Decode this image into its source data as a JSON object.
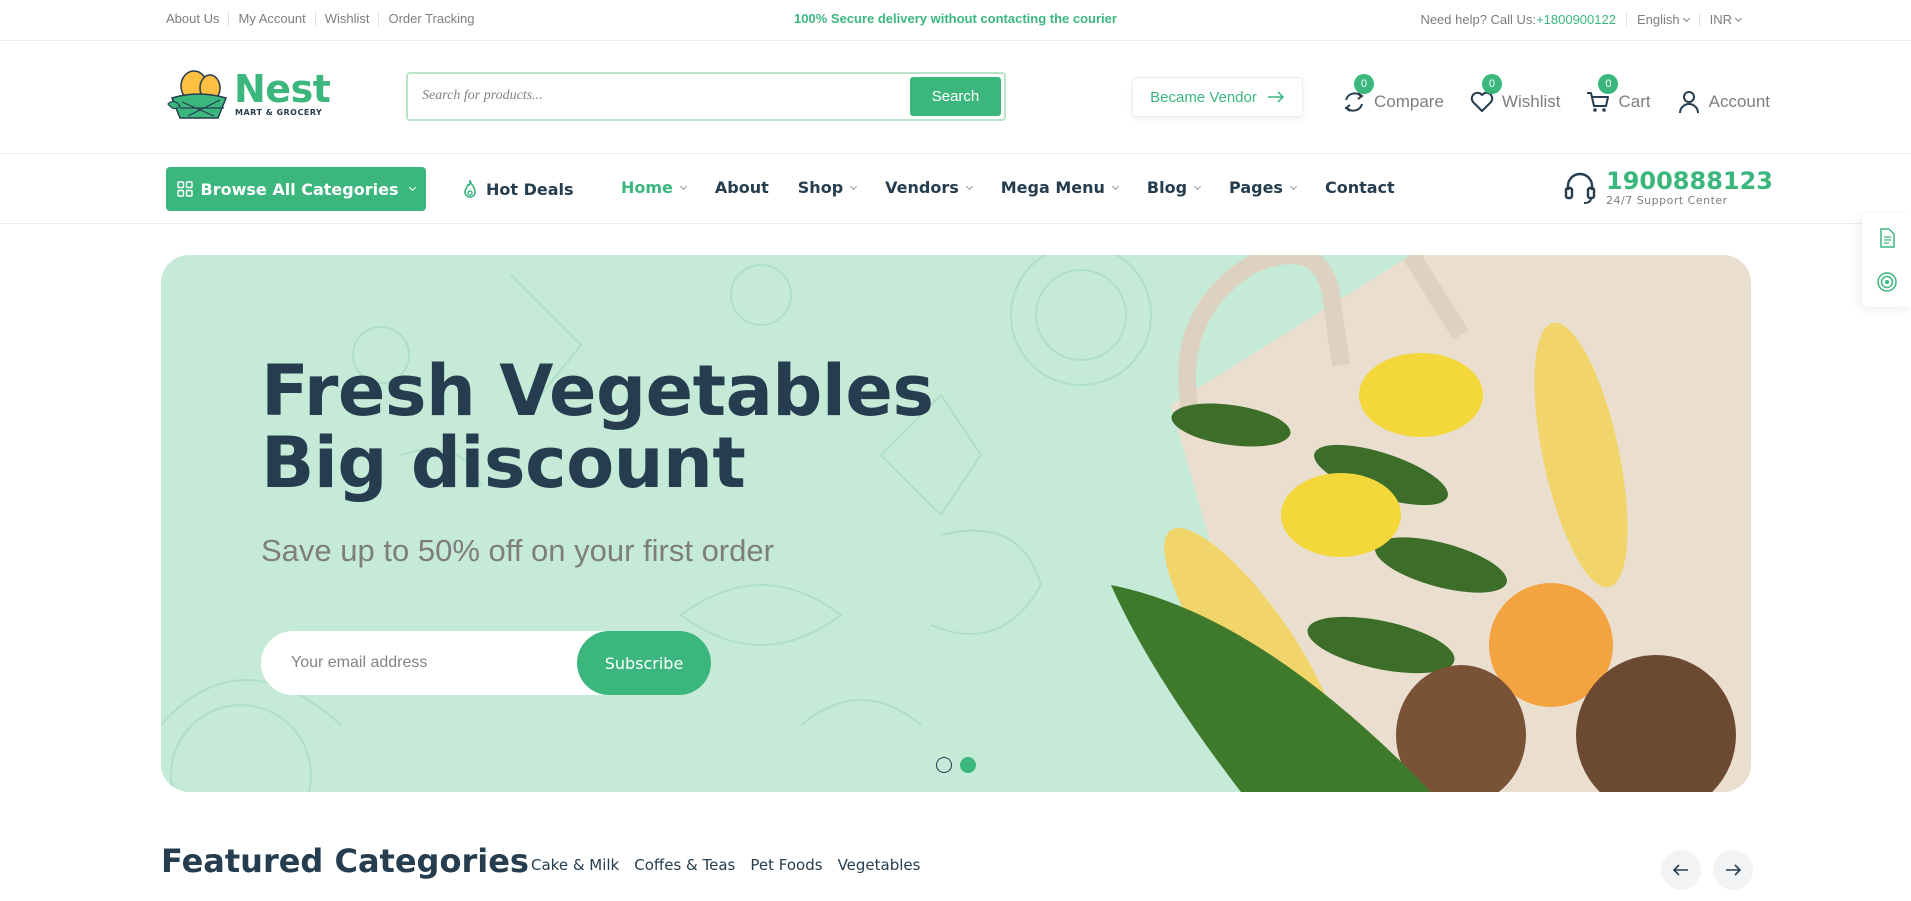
{
  "topbar": {
    "links": [
      "About Us",
      "My Account",
      "Wishlist",
      "Order Tracking"
    ],
    "promo": "100% Secure delivery without contacting the courier",
    "help_prefix": "Need help? Call Us:",
    "help_phone": "+1800900122",
    "language": "English",
    "currency": "INR"
  },
  "header": {
    "logo_name": "Nest",
    "logo_tagline": "MART & GROCERY",
    "search_placeholder": "Search for products...",
    "search_button": "Search",
    "vendor_button": "Became Vendor",
    "compare": {
      "label": "Compare",
      "count": "0"
    },
    "wishlist": {
      "label": "Wishlist",
      "count": "0"
    },
    "cart": {
      "label": "Cart",
      "count": "0"
    },
    "account": {
      "label": "Account"
    }
  },
  "nav": {
    "browse": "Browse All Categories",
    "hot_deals": "Hot Deals",
    "items": [
      {
        "label": "Home",
        "dropdown": true,
        "active": true
      },
      {
        "label": "About",
        "dropdown": false
      },
      {
        "label": "Shop",
        "dropdown": true
      },
      {
        "label": "Vendors",
        "dropdown": true
      },
      {
        "label": "Mega Menu",
        "dropdown": true
      },
      {
        "label": "Blog",
        "dropdown": true
      },
      {
        "label": "Pages",
        "dropdown": true
      },
      {
        "label": "Contact",
        "dropdown": false
      }
    ],
    "support_number": "1900888123",
    "support_label": "24/7 Support Center"
  },
  "hero": {
    "title_line1": "Fresh Vegetables",
    "title_line2": "Big discount",
    "subtitle": "Save up to 50% off on your first order",
    "email_placeholder": "Your email address",
    "subscribe_button": "Subscribe",
    "slide_count": 2,
    "active_slide": 2
  },
  "featured": {
    "title": "Featured Categories",
    "tabs": [
      "Cake & Milk",
      "Coffes & Teas",
      "Pet Foods",
      "Vegetables"
    ]
  },
  "colors": {
    "brand_green": "#3bb77e",
    "heading": "#253d4e",
    "muted": "#7e7e7e",
    "hero_bg": "#c5ead8"
  },
  "icons": [
    "compare-icon",
    "heart-icon",
    "cart-icon",
    "user-icon",
    "grid-icon",
    "fire-icon",
    "headset-icon",
    "arrow-right-icon",
    "arrow-left-icon",
    "document-icon",
    "target-icon"
  ]
}
